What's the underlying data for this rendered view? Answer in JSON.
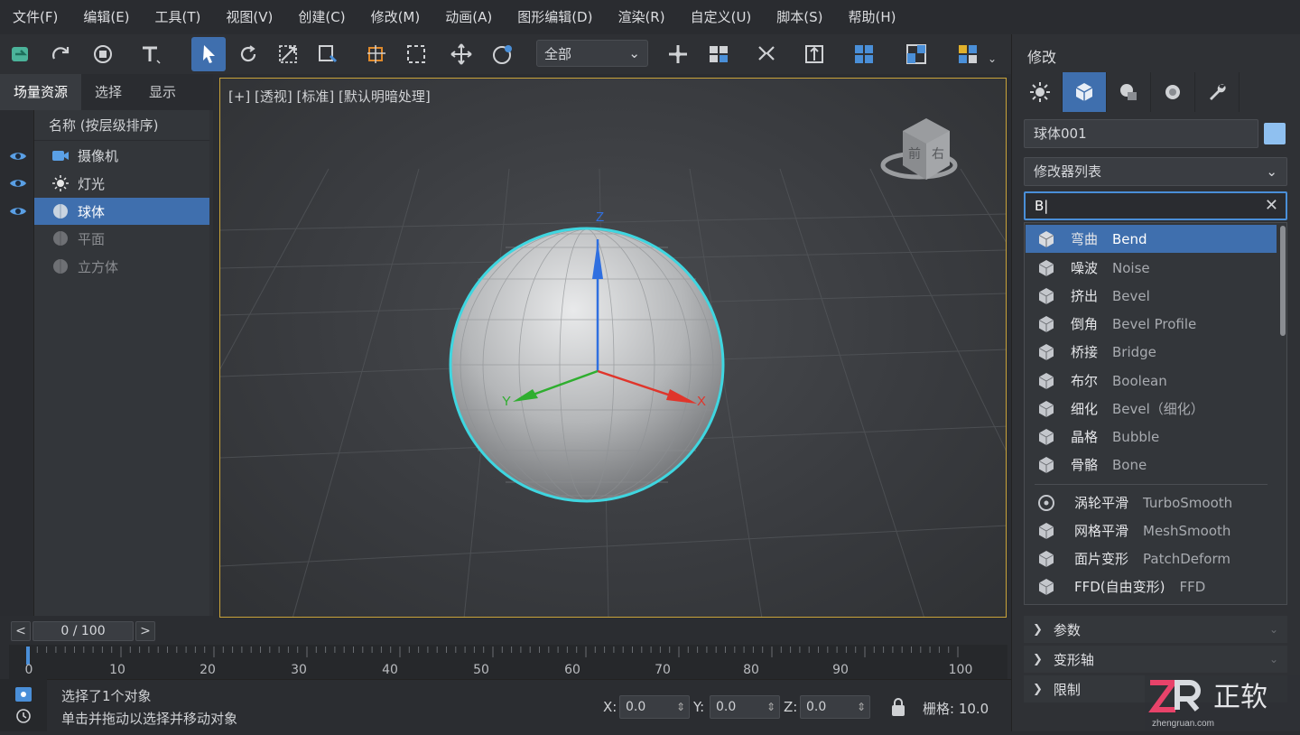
{
  "menu": [
    "文件(F)",
    "编辑(E)",
    "工具(T)",
    "视图(V)",
    "创建(C)",
    "修改(M)",
    "动画(A)",
    "图形编辑(D)",
    "渲染(R)",
    "自定义(U)",
    "脚本(S)",
    "帮助(H)"
  ],
  "toolbar": {
    "selection_filter": "全部"
  },
  "scene_explorer": {
    "tabs": [
      "场量资源",
      "选择",
      "显示"
    ],
    "header": "名称 (按层级排序)",
    "items": [
      {
        "label": "摄像机",
        "icon": "camera-icon",
        "visible": true,
        "selected": false
      },
      {
        "label": "灯光",
        "icon": "light-icon",
        "visible": true,
        "selected": false
      },
      {
        "label": "球体",
        "icon": "sphere-icon",
        "visible": true,
        "selected": true
      },
      {
        "label": "平面",
        "icon": "plane-icon",
        "visible": false,
        "selected": false
      },
      {
        "label": "立方体",
        "icon": "box-icon",
        "visible": false,
        "selected": false
      }
    ]
  },
  "viewport": {
    "label": "[+] [透视] [标准] [默认明暗处理]",
    "viewcube": {
      "front": "前",
      "right": "右"
    },
    "axes": {
      "x": "X",
      "y": "Y",
      "z": "Z"
    }
  },
  "timeline": {
    "frame": "0 / 100",
    "prev": "<",
    "next": ">",
    "ticks": [
      "0",
      "10",
      "20",
      "30",
      "40",
      "50",
      "60",
      "70",
      "80",
      "90",
      "100"
    ]
  },
  "status": {
    "line1": "选择了1个对象",
    "line2": "单击并拖动以选择并移动对象",
    "x_label": "X:",
    "x_value": "0.0",
    "y_label": "Y:",
    "y_value": "0.0",
    "z_label": "Z:",
    "z_value": "0.0",
    "grid": "栅格: 10.0"
  },
  "modify_panel": {
    "title": "修改",
    "object_name": "球体001",
    "object_color": "#8fc0f0",
    "modifier_list": "修改器列表",
    "search_value": "B|",
    "results": [
      {
        "zh": "弯曲",
        "en": "Bend",
        "highlight": true
      },
      {
        "zh": "噪波",
        "en": "Noise"
      },
      {
        "zh": "挤出",
        "en": "Bevel"
      },
      {
        "zh": "倒角",
        "en": "Bevel Profile"
      },
      {
        "zh": "桥接",
        "en": "Bridge"
      },
      {
        "zh": "布尔",
        "en": "Boolean"
      },
      {
        "zh": "细化",
        "en": "Bevel（细化）"
      },
      {
        "zh": "晶格",
        "en": "Bubble"
      },
      {
        "zh": "骨骼",
        "en": "Bone"
      }
    ],
    "results2": [
      {
        "zh": "涡轮平滑",
        "en": "TurboSmooth",
        "icon": "turbosmooth-icon"
      },
      {
        "zh": "网格平滑",
        "en": "MeshSmooth"
      },
      {
        "zh": "面片变形",
        "en": "PatchDeform"
      },
      {
        "zh": "FFD(自由变形)",
        "en": "FFD"
      }
    ],
    "rollouts": [
      "参数",
      "变形轴",
      "限制"
    ]
  },
  "watermark": {
    "text": "正软",
    "sub": "zhengruan.com"
  },
  "colors": {
    "accent": "#3f6fae",
    "selection_ring": "#3fd6e0",
    "x_axis": "#e0352b",
    "y_axis": "#2fae2f",
    "z_axis": "#2f6fe0",
    "viewport_border": "#c9a33a"
  }
}
